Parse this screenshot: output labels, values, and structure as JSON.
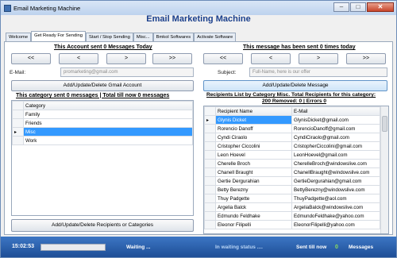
{
  "window": {
    "title": "Email Marketing Machine",
    "min_label": "–",
    "max_label": "□",
    "close_label": "✕"
  },
  "heading": "Email Marketing Machine",
  "tabs": [
    {
      "label": "Welcome"
    },
    {
      "label": "Get Ready For Sending"
    },
    {
      "label": "Start / Stop Sending"
    },
    {
      "label": "Misc..."
    },
    {
      "label": "Bmkol Softwares"
    },
    {
      "label": "Activate Software"
    }
  ],
  "account_section": {
    "title": "This Account sent 0 Messages Today",
    "nav": [
      "<<",
      "<",
      ">",
      ">>"
    ],
    "email_label": "E-Mail:",
    "email_value": "promarketing@gmail.com",
    "add_button": "Add/Update/Delete Gmail Account"
  },
  "message_section": {
    "title": "This message has been sent 0 times today",
    "nav": [
      "<<",
      "<",
      ">",
      ">>"
    ],
    "subject_label": "Subject:",
    "subject_value": "Full-Name, here is our offer",
    "add_button": "Add/Update/Delete Message"
  },
  "category_section": {
    "title": "This category sent 0 messages | Total till now 0 messages",
    "column": "Category",
    "rows": [
      "Family",
      "Friends",
      "Misc",
      "Work"
    ],
    "selected_index": 2,
    "add_button": "Add/Update/Delete Recipients or Categories"
  },
  "recipients_section": {
    "title_line1": "Recipients List by Category Misc. Total Recipients for this category:",
    "title_line2": "200 Removed: 0 | Errors 0",
    "columns": [
      "Recipient Name",
      "E-Mail"
    ],
    "rows": [
      {
        "name": "Glynis Dicket",
        "email": "GlynisDicket@gmail.com"
      },
      {
        "name": "Rorencio Danoff",
        "email": "RorencioDanoff@gmail.com"
      },
      {
        "name": "Cyndi Ciraolo",
        "email": "CyndiCiraolo@gmail.com"
      },
      {
        "name": "Cristopher Ciccolini",
        "email": "CristopherCiccolini@gmail.com"
      },
      {
        "name": "Leon Hoevel",
        "email": "LeonHoevel@gmail.com"
      },
      {
        "name": "Cherelle Broch",
        "email": "CherelleBroch@windowslive.com"
      },
      {
        "name": "Chanell Braught",
        "email": "ChanellBraught@windowslive.com"
      },
      {
        "name": "Gertie Dergurahian",
        "email": "GertieDergurahian@gmail.com"
      },
      {
        "name": "Betty Berezny",
        "email": "BettyBerezny@windowslive.com"
      },
      {
        "name": "Thuy Padgette",
        "email": "ThuyPadgette@aol.com"
      },
      {
        "name": "Argelia Balck",
        "email": "ArgeliaBalck@windowslive.com"
      },
      {
        "name": "Edmundo Feldhake",
        "email": "EdmundoFeldhake@yahoo.com"
      },
      {
        "name": "Eleonor Filipelli",
        "email": "EleonorFilipelli@yahoo.com"
      }
    ],
    "selected_index": 0
  },
  "status": {
    "time": "15:02:53",
    "waiting": "Waiting ...",
    "waiting_status": "In waiting status ....",
    "sent_label": "Sent till now",
    "sent_count": "0",
    "messages_label": "Messages",
    "progress": 0
  },
  "colors": {
    "accent": "#1a3f8c",
    "selection": "#3399ff",
    "statusbar": "#2a5fa8",
    "count": "#8ee05b"
  }
}
